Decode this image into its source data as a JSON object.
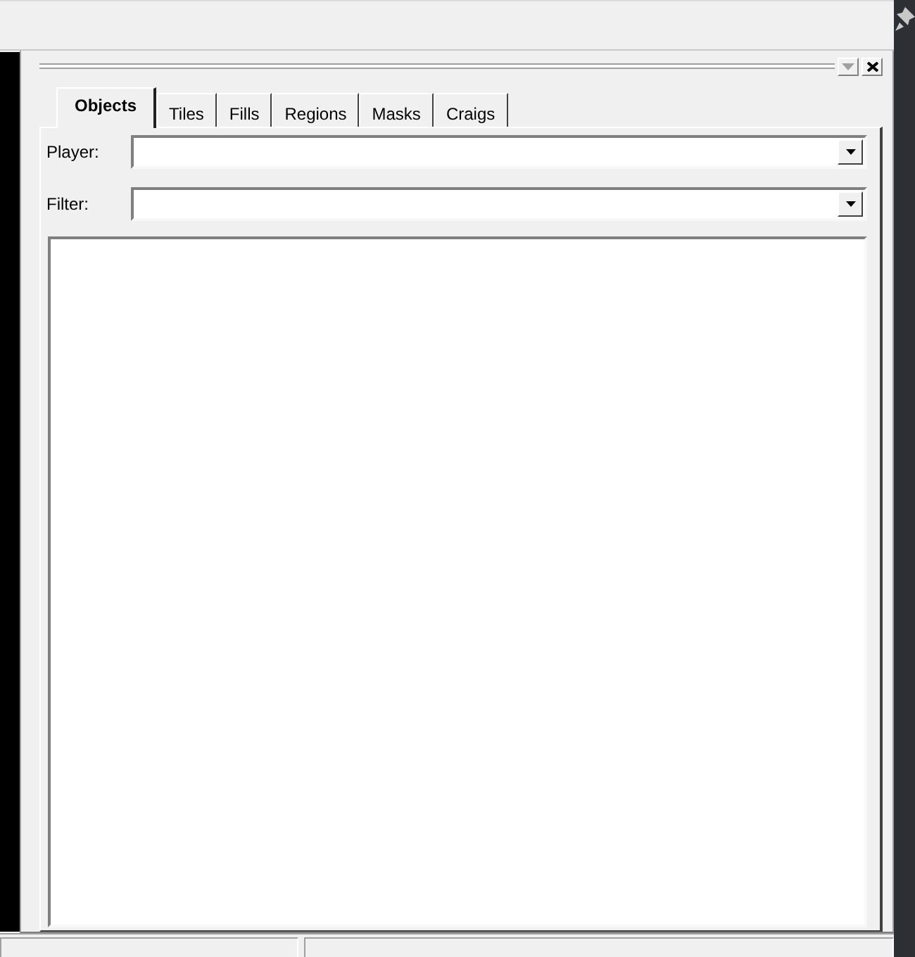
{
  "panel": {
    "tabs": [
      {
        "label": "Objects",
        "selected": true
      },
      {
        "label": "Tiles",
        "selected": false
      },
      {
        "label": "Fills",
        "selected": false
      },
      {
        "label": "Regions",
        "selected": false
      },
      {
        "label": "Masks",
        "selected": false
      },
      {
        "label": "Craigs",
        "selected": false
      }
    ],
    "fields": [
      {
        "label": "Player:"
      },
      {
        "label": "Filter:"
      }
    ]
  }
}
